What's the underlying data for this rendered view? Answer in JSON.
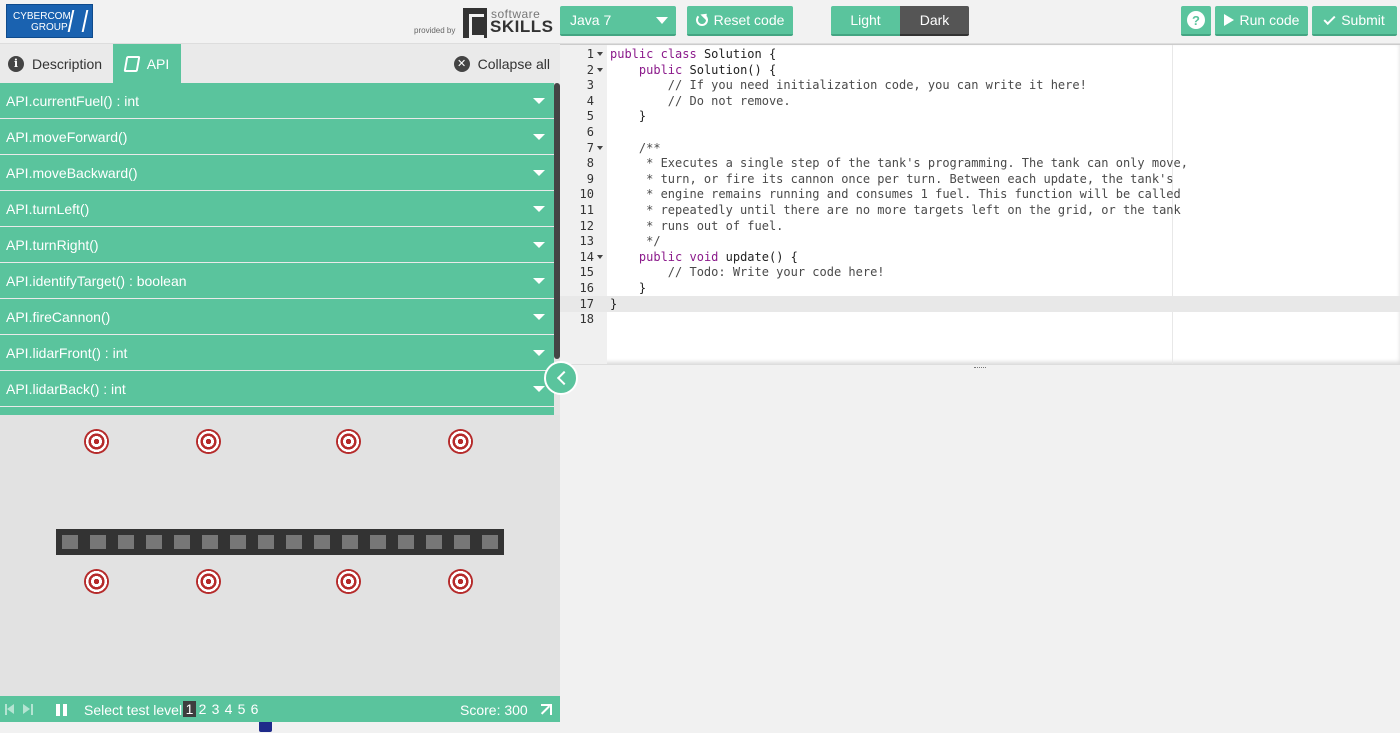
{
  "header": {
    "logo_line1": "CYBERCOM",
    "logo_line2": "GROUP",
    "provided_by": "provided by",
    "brand_small": "software",
    "brand_large": "SKILLS",
    "language": "Java 7",
    "reset_label": "Reset code",
    "theme_light": "Light",
    "theme_dark": "Dark",
    "help_label": "?",
    "run_label": "Run code",
    "submit_label": "Submit",
    "accent_color": "#5ac49d"
  },
  "tabs": {
    "description": "Description",
    "api": "API",
    "collapse_all": "Collapse all"
  },
  "api_items": [
    "API.currentFuel() : int",
    "API.moveForward()",
    "API.moveBackward()",
    "API.turnLeft()",
    "API.turnRight()",
    "API.identifyTarget() : boolean",
    "API.fireCannon()",
    "API.lidarFront() : int",
    "API.lidarBack() : int"
  ],
  "status_bar": {
    "select_level_label": "Select test level",
    "levels": [
      "1",
      "2",
      "3",
      "4",
      "5",
      "6"
    ],
    "active_level": "1",
    "score": "Score: 300"
  },
  "code": {
    "active_line": 17,
    "lines": [
      "public class Solution {",
      "    public Solution() {",
      "        // If you need initialization code, you can write it here!",
      "        // Do not remove.",
      "    }",
      "",
      "    /**",
      "     * Executes a single step of the tank's programming. The tank can only move,",
      "     * turn, or fire its cannon once per turn. Between each update, the tank's",
      "     * engine remains running and consumes 1 fuel. This function will be called",
      "     * repeatedly until there are no more targets left on the grid, or the tank",
      "     * runs out of fuel.",
      "     */",
      "    public void update() {",
      "        // Todo: Write your code here!",
      "    }",
      "}",
      ""
    ],
    "fold_lines": [
      1,
      2,
      7,
      14
    ]
  }
}
